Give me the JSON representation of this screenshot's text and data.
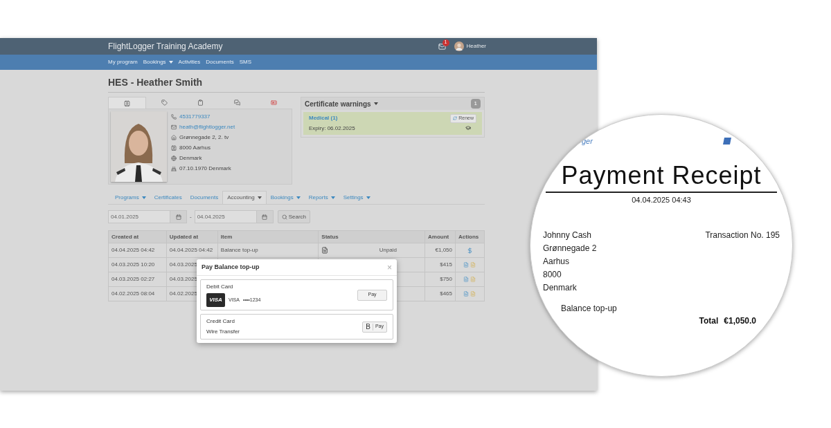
{
  "header": {
    "title": "FlightLogger Training Academy",
    "mail_count": "1",
    "user": "Heather"
  },
  "nav": [
    {
      "label": "My program",
      "dropdown": false
    },
    {
      "label": "Bookings",
      "dropdown": true
    },
    {
      "label": "Activities",
      "dropdown": false
    },
    {
      "label": "Documents",
      "dropdown": false
    },
    {
      "label": "SMS",
      "dropdown": false
    }
  ],
  "page_title": "HES - Heather Smith",
  "profile_tabs": [
    {
      "kind": "id",
      "selected": true
    },
    {
      "kind": "tags",
      "selected": false
    },
    {
      "kind": "clipboard",
      "selected": false
    },
    {
      "kind": "chat",
      "selected": false
    },
    {
      "kind": "alert",
      "selected": false
    }
  ],
  "contacts": [
    {
      "kind": "phone",
      "text": "4531779337",
      "link": true
    },
    {
      "kind": "mail",
      "text": "heath@flightlogger.net",
      "link": true
    },
    {
      "kind": "home",
      "text": "Grønnegade 2, 2. tv",
      "link": false
    },
    {
      "kind": "post",
      "text": "8000 Aarhus",
      "link": false
    },
    {
      "kind": "globe",
      "text": "Denmark",
      "link": false
    },
    {
      "kind": "birth",
      "text": "07.10.1970 Denmark",
      "link": false
    }
  ],
  "warnings": {
    "title": "Certificate warnings",
    "count": "1",
    "items": [
      {
        "name": "Medical (1)",
        "expiry": "Expiry: 06.02.2025",
        "action": "Renew"
      }
    ]
  },
  "subtabs": [
    {
      "label": "Programs",
      "dropdown": true,
      "selected": false
    },
    {
      "label": "Certificates",
      "dropdown": false,
      "selected": false
    },
    {
      "label": "Documents",
      "dropdown": false,
      "selected": false
    },
    {
      "label": "Accounting",
      "dropdown": true,
      "selected": true
    },
    {
      "label": "Bookings",
      "dropdown": true,
      "selected": false
    },
    {
      "label": "Reports",
      "dropdown": true,
      "selected": false
    },
    {
      "label": "Settings",
      "dropdown": true,
      "selected": false
    }
  ],
  "filter": {
    "from": "04.01.2025",
    "separator": "-",
    "to": "04.04.2025",
    "search": "Search"
  },
  "table": {
    "columns": [
      "Created at",
      "Updated at",
      "Item",
      "Status",
      "Amount",
      "Actions"
    ],
    "rows": [
      {
        "created": "04.04.2025 04:42",
        "updated": "04.04.2025 04:42",
        "item": "Balance top-up",
        "status": "Unpaid",
        "amount": "€1,050",
        "kind": "pay"
      },
      {
        "created": "04.03.2025 10:20",
        "updated": "04.03.2025",
        "amount": "$415",
        "kind": "docs"
      },
      {
        "created": "04.03.2025 02:27",
        "updated": "04.03.2025",
        "amount": "$750",
        "kind": "docs"
      },
      {
        "created": "04.02.2025 08:04",
        "updated": "04.02.2025",
        "amount": "$465",
        "kind": "docs"
      }
    ]
  },
  "modal": {
    "title": "Pay Balance top-up",
    "close": "×",
    "options": [
      {
        "kind": "card",
        "lines": [
          "Debit Card"
        ],
        "logo": "VISA",
        "brand": "VISA",
        "number": "••••1234",
        "button": "Pay"
      },
      {
        "kind": "bank",
        "lines": [
          "Credit Card",
          "Wire Transfer"
        ],
        "button_mark": "B",
        "button": "Pay"
      }
    ]
  },
  "receipt": {
    "brand": "ger",
    "title": "Payment Receipt",
    "date": "04.04.2025 04:43",
    "address": [
      "Johnny Cash",
      "Grønnegade 2",
      "Aarhus",
      "8000",
      "Denmark"
    ],
    "transaction": "Transaction No. 195",
    "item": "Balance top-up",
    "total_label": "Total",
    "total": "€1,050.0"
  }
}
